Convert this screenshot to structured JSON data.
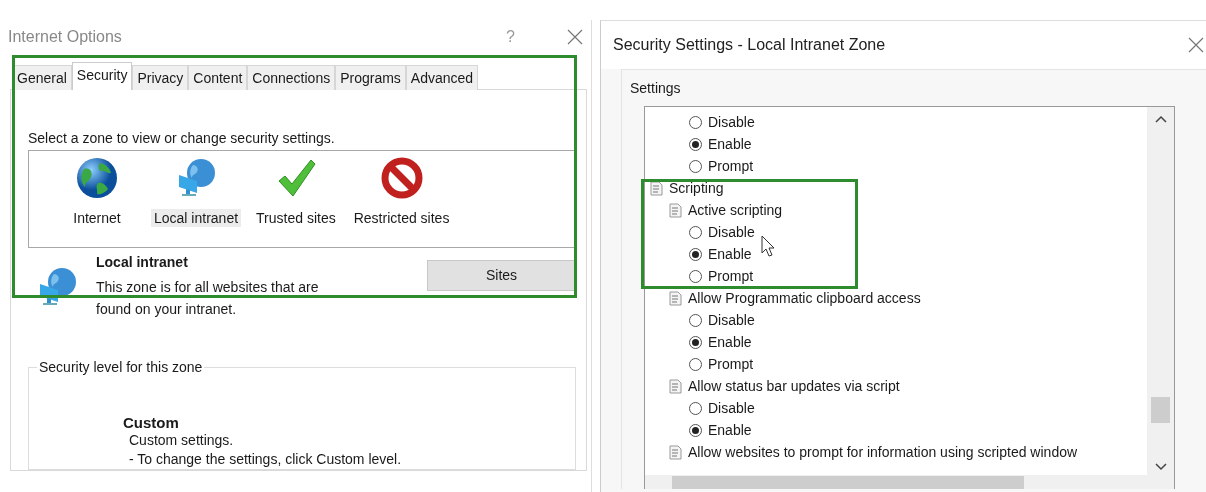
{
  "internet_options": {
    "title": "Internet Options",
    "help": "?",
    "tabs": [
      {
        "label": "General",
        "selected": false
      },
      {
        "label": "Security",
        "selected": true
      },
      {
        "label": "Privacy",
        "selected": false
      },
      {
        "label": "Content",
        "selected": false
      },
      {
        "label": "Connections",
        "selected": false
      },
      {
        "label": "Programs",
        "selected": false
      },
      {
        "label": "Advanced",
        "selected": false
      }
    ],
    "zone_prompt": "Select a zone to view or change security settings.",
    "zones": [
      {
        "label": "Internet",
        "kind": "globe",
        "selected": false
      },
      {
        "label": "Local intranet",
        "kind": "intranet",
        "selected": true
      },
      {
        "label": "Trusted sites",
        "kind": "check",
        "selected": false
      },
      {
        "label": "Restricted sites",
        "kind": "blocked",
        "selected": false
      }
    ],
    "zone_info": {
      "name": "Local intranet",
      "description": "This zone is for all websites that are found on your intranet."
    },
    "sites_button": "Sites",
    "security_level": {
      "legend": "Security level for this zone",
      "level_name": "Custom",
      "lines": [
        "Custom settings.",
        "- To change the settings, click Custom level."
      ]
    }
  },
  "security_settings": {
    "title": "Security Settings - Local Intranet Zone",
    "settings_label": "Settings",
    "tree": [
      {
        "kind": "options",
        "options": [
          {
            "label": "Disable",
            "selected": false
          },
          {
            "label": "Enable",
            "selected": true
          },
          {
            "label": "Prompt",
            "selected": false
          }
        ]
      },
      {
        "kind": "category",
        "label": "Scripting",
        "children": [
          {
            "kind": "setting",
            "label": "Active scripting",
            "options": [
              {
                "label": "Disable",
                "selected": false
              },
              {
                "label": "Enable",
                "selected": true
              },
              {
                "label": "Prompt",
                "selected": false
              }
            ]
          },
          {
            "kind": "setting",
            "label": "Allow Programmatic clipboard access",
            "options": [
              {
                "label": "Disable",
                "selected": false
              },
              {
                "label": "Enable",
                "selected": true
              },
              {
                "label": "Prompt",
                "selected": false
              }
            ]
          },
          {
            "kind": "setting",
            "label": "Allow status bar updates via script",
            "options": [
              {
                "label": "Disable",
                "selected": false
              },
              {
                "label": "Enable",
                "selected": true
              }
            ]
          },
          {
            "kind": "setting",
            "label": "Allow websites to prompt for information using scripted window"
          }
        ]
      }
    ]
  }
}
